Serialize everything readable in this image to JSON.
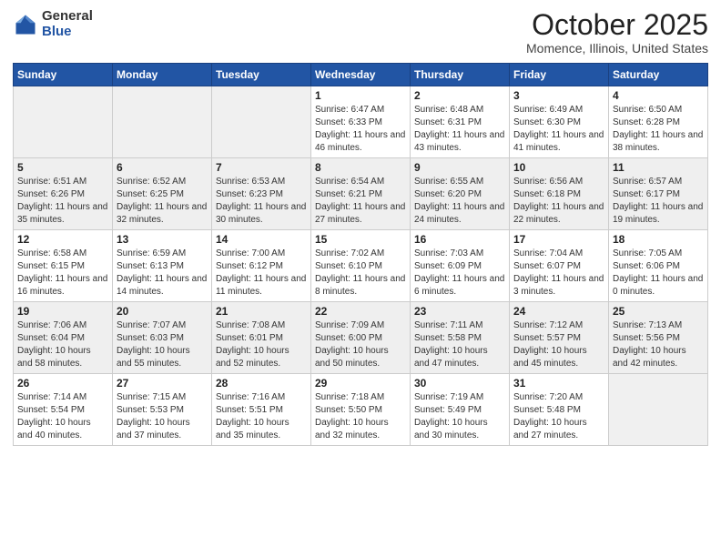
{
  "header": {
    "logo_general": "General",
    "logo_blue": "Blue",
    "month_title": "October 2025",
    "location": "Momence, Illinois, United States"
  },
  "weekdays": [
    "Sunday",
    "Monday",
    "Tuesday",
    "Wednesday",
    "Thursday",
    "Friday",
    "Saturday"
  ],
  "weeks": [
    [
      {
        "day": "",
        "info": "",
        "empty": true
      },
      {
        "day": "",
        "info": "",
        "empty": true
      },
      {
        "day": "",
        "info": "",
        "empty": true
      },
      {
        "day": "1",
        "info": "Sunrise: 6:47 AM\nSunset: 6:33 PM\nDaylight: 11 hours and 46 minutes."
      },
      {
        "day": "2",
        "info": "Sunrise: 6:48 AM\nSunset: 6:31 PM\nDaylight: 11 hours and 43 minutes."
      },
      {
        "day": "3",
        "info": "Sunrise: 6:49 AM\nSunset: 6:30 PM\nDaylight: 11 hours and 41 minutes."
      },
      {
        "day": "4",
        "info": "Sunrise: 6:50 AM\nSunset: 6:28 PM\nDaylight: 11 hours and 38 minutes."
      }
    ],
    [
      {
        "day": "5",
        "info": "Sunrise: 6:51 AM\nSunset: 6:26 PM\nDaylight: 11 hours and 35 minutes."
      },
      {
        "day": "6",
        "info": "Sunrise: 6:52 AM\nSunset: 6:25 PM\nDaylight: 11 hours and 32 minutes."
      },
      {
        "day": "7",
        "info": "Sunrise: 6:53 AM\nSunset: 6:23 PM\nDaylight: 11 hours and 30 minutes."
      },
      {
        "day": "8",
        "info": "Sunrise: 6:54 AM\nSunset: 6:21 PM\nDaylight: 11 hours and 27 minutes."
      },
      {
        "day": "9",
        "info": "Sunrise: 6:55 AM\nSunset: 6:20 PM\nDaylight: 11 hours and 24 minutes."
      },
      {
        "day": "10",
        "info": "Sunrise: 6:56 AM\nSunset: 6:18 PM\nDaylight: 11 hours and 22 minutes."
      },
      {
        "day": "11",
        "info": "Sunrise: 6:57 AM\nSunset: 6:17 PM\nDaylight: 11 hours and 19 minutes."
      }
    ],
    [
      {
        "day": "12",
        "info": "Sunrise: 6:58 AM\nSunset: 6:15 PM\nDaylight: 11 hours and 16 minutes."
      },
      {
        "day": "13",
        "info": "Sunrise: 6:59 AM\nSunset: 6:13 PM\nDaylight: 11 hours and 14 minutes."
      },
      {
        "day": "14",
        "info": "Sunrise: 7:00 AM\nSunset: 6:12 PM\nDaylight: 11 hours and 11 minutes."
      },
      {
        "day": "15",
        "info": "Sunrise: 7:02 AM\nSunset: 6:10 PM\nDaylight: 11 hours and 8 minutes."
      },
      {
        "day": "16",
        "info": "Sunrise: 7:03 AM\nSunset: 6:09 PM\nDaylight: 11 hours and 6 minutes."
      },
      {
        "day": "17",
        "info": "Sunrise: 7:04 AM\nSunset: 6:07 PM\nDaylight: 11 hours and 3 minutes."
      },
      {
        "day": "18",
        "info": "Sunrise: 7:05 AM\nSunset: 6:06 PM\nDaylight: 11 hours and 0 minutes."
      }
    ],
    [
      {
        "day": "19",
        "info": "Sunrise: 7:06 AM\nSunset: 6:04 PM\nDaylight: 10 hours and 58 minutes."
      },
      {
        "day": "20",
        "info": "Sunrise: 7:07 AM\nSunset: 6:03 PM\nDaylight: 10 hours and 55 minutes."
      },
      {
        "day": "21",
        "info": "Sunrise: 7:08 AM\nSunset: 6:01 PM\nDaylight: 10 hours and 52 minutes."
      },
      {
        "day": "22",
        "info": "Sunrise: 7:09 AM\nSunset: 6:00 PM\nDaylight: 10 hours and 50 minutes."
      },
      {
        "day": "23",
        "info": "Sunrise: 7:11 AM\nSunset: 5:58 PM\nDaylight: 10 hours and 47 minutes."
      },
      {
        "day": "24",
        "info": "Sunrise: 7:12 AM\nSunset: 5:57 PM\nDaylight: 10 hours and 45 minutes."
      },
      {
        "day": "25",
        "info": "Sunrise: 7:13 AM\nSunset: 5:56 PM\nDaylight: 10 hours and 42 minutes."
      }
    ],
    [
      {
        "day": "26",
        "info": "Sunrise: 7:14 AM\nSunset: 5:54 PM\nDaylight: 10 hours and 40 minutes."
      },
      {
        "day": "27",
        "info": "Sunrise: 7:15 AM\nSunset: 5:53 PM\nDaylight: 10 hours and 37 minutes."
      },
      {
        "day": "28",
        "info": "Sunrise: 7:16 AM\nSunset: 5:51 PM\nDaylight: 10 hours and 35 minutes."
      },
      {
        "day": "29",
        "info": "Sunrise: 7:18 AM\nSunset: 5:50 PM\nDaylight: 10 hours and 32 minutes."
      },
      {
        "day": "30",
        "info": "Sunrise: 7:19 AM\nSunset: 5:49 PM\nDaylight: 10 hours and 30 minutes."
      },
      {
        "day": "31",
        "info": "Sunrise: 7:20 AM\nSunset: 5:48 PM\nDaylight: 10 hours and 27 minutes."
      },
      {
        "day": "",
        "info": "",
        "empty": true
      }
    ]
  ]
}
